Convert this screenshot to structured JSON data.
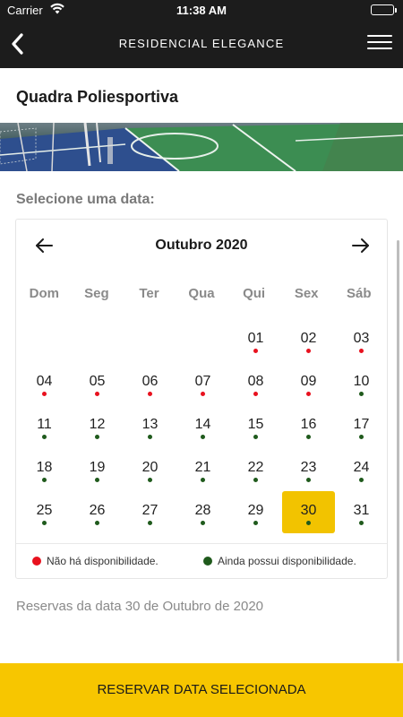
{
  "status_bar": {
    "carrier": "Carrier",
    "time": "11:38 AM"
  },
  "nav": {
    "title": "RESIDENCIAL ELEGANCE",
    "back_icon": "chevron-left-icon",
    "menu_icon": "hamburger-menu-icon"
  },
  "court": {
    "title": "Quadra Poliesportiva"
  },
  "select_label": "Selecione uma data:",
  "calendar": {
    "month_label": "Outubro 2020",
    "weekdays": [
      "Dom",
      "Seg",
      "Ter",
      "Qua",
      "Qui",
      "Sex",
      "Sáb"
    ],
    "leading_blanks": 4,
    "days": [
      {
        "day": "01",
        "availability": "unavailable"
      },
      {
        "day": "02",
        "availability": "unavailable"
      },
      {
        "day": "03",
        "availability": "unavailable"
      },
      {
        "day": "04",
        "availability": "unavailable"
      },
      {
        "day": "05",
        "availability": "unavailable"
      },
      {
        "day": "06",
        "availability": "unavailable"
      },
      {
        "day": "07",
        "availability": "unavailable"
      },
      {
        "day": "08",
        "availability": "unavailable"
      },
      {
        "day": "09",
        "availability": "unavailable"
      },
      {
        "day": "10",
        "availability": "available"
      },
      {
        "day": "11",
        "availability": "available"
      },
      {
        "day": "12",
        "availability": "available"
      },
      {
        "day": "13",
        "availability": "available"
      },
      {
        "day": "14",
        "availability": "available"
      },
      {
        "day": "15",
        "availability": "available"
      },
      {
        "day": "16",
        "availability": "available"
      },
      {
        "day": "17",
        "availability": "available"
      },
      {
        "day": "18",
        "availability": "available"
      },
      {
        "day": "19",
        "availability": "available"
      },
      {
        "day": "20",
        "availability": "available"
      },
      {
        "day": "21",
        "availability": "available"
      },
      {
        "day": "22",
        "availability": "available"
      },
      {
        "day": "23",
        "availability": "available"
      },
      {
        "day": "24",
        "availability": "available"
      },
      {
        "day": "25",
        "availability": "available"
      },
      {
        "day": "26",
        "availability": "available"
      },
      {
        "day": "27",
        "availability": "available"
      },
      {
        "day": "28",
        "availability": "available"
      },
      {
        "day": "29",
        "availability": "available"
      },
      {
        "day": "30",
        "availability": "available",
        "selected": true
      },
      {
        "day": "31",
        "availability": "available"
      }
    ],
    "legend": {
      "unavailable": "Não há disponibilidade.",
      "available": "Ainda possui disponibilidade."
    }
  },
  "reservations_label": "Reservas da data 30 de Outubro de 2020",
  "reserve_button": "RESERVAR DATA SELECIONADA",
  "colors": {
    "accent": "#f7c600",
    "selected_day": "#f2c300",
    "unavailable_dot": "#e8111e",
    "available_dot": "#1f5a1c",
    "header_bg": "#1c1c1c"
  }
}
